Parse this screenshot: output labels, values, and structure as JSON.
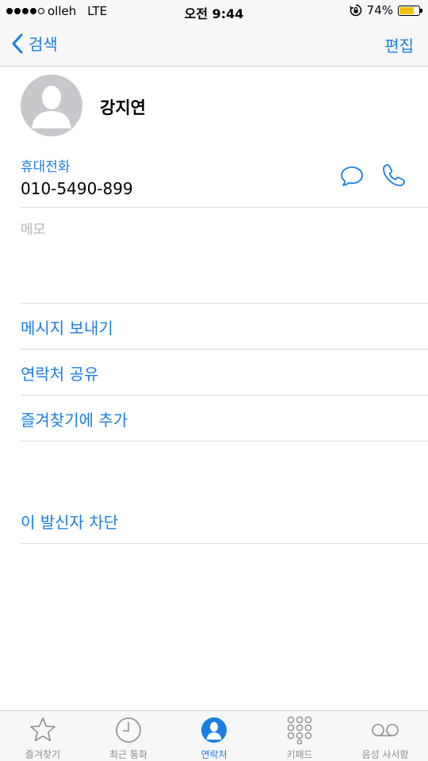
{
  "status_bar": {
    "carrier": "olleh",
    "network": "LTE",
    "time": "오전 9:44",
    "battery_percent": "74%",
    "battery_level": 0.74,
    "signal_bars": 4
  },
  "nav": {
    "back_label": "검색",
    "edit_label": "편집"
  },
  "contact": {
    "name": "강지연",
    "phone_label": "휴대전화",
    "phone_number": "010-5490-899",
    "memo_label": "메모"
  },
  "actions": {
    "send_message": "메시지 보내기",
    "share_contact": "연락처 공유",
    "add_favorite": "즐겨찾기에 추가",
    "block_caller": "이 발신자 차단"
  },
  "tabs": [
    {
      "label": "즐겨찾기",
      "icon": "star-icon",
      "active": false
    },
    {
      "label": "최근 통화",
      "icon": "clock-icon",
      "active": false
    },
    {
      "label": "연락처",
      "icon": "contacts-icon",
      "active": true
    },
    {
      "label": "키패드",
      "icon": "keypad-icon",
      "active": false
    },
    {
      "label": "음성 사서함",
      "icon": "voicemail-icon",
      "active": false
    }
  ],
  "colors": {
    "accent": "#1a7fe0",
    "battery": "#f5c211",
    "inactive_tab": "#8e8e93"
  }
}
